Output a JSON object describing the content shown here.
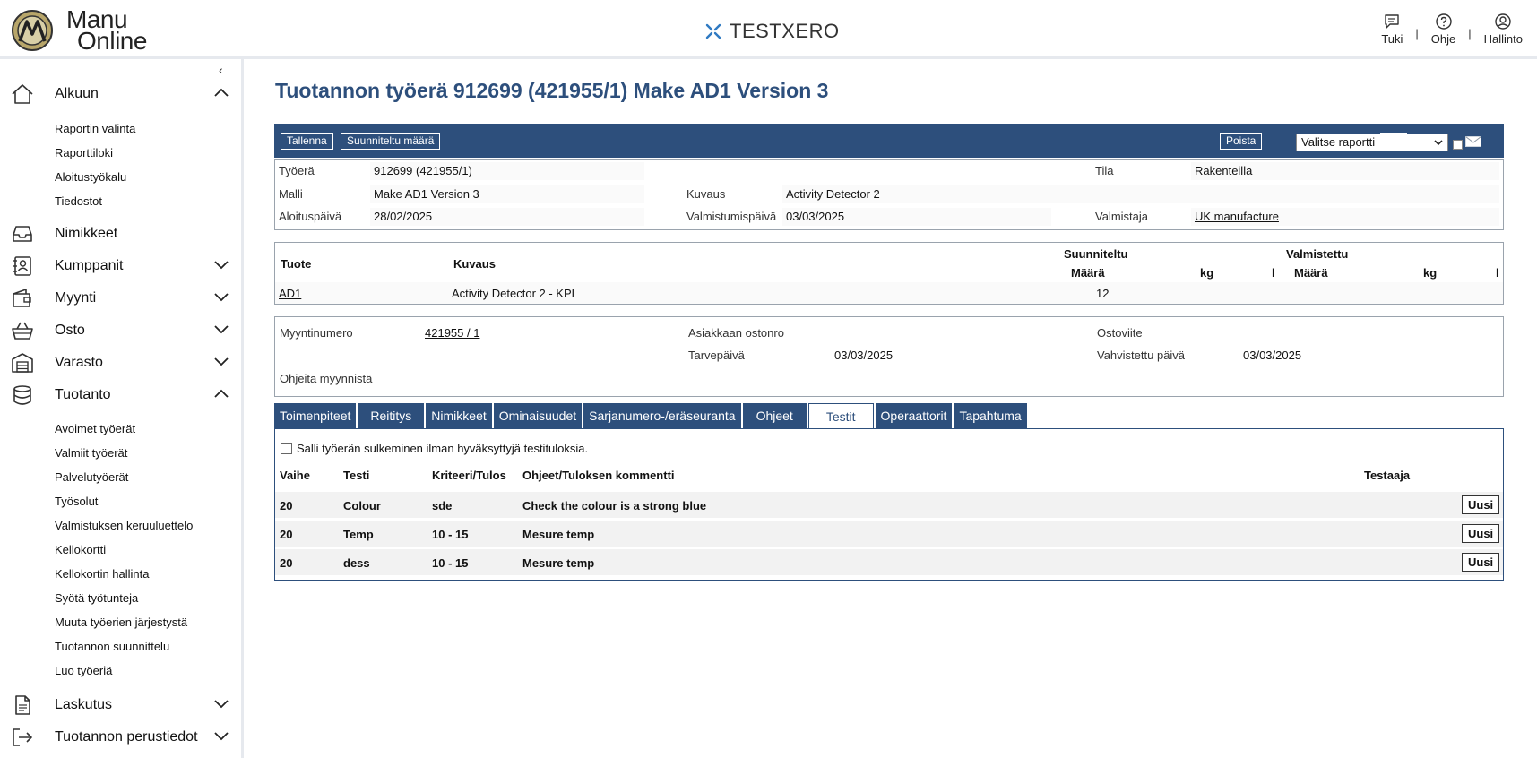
{
  "header": {
    "logo_line1": "Manu",
    "logo_line2": "Online",
    "brand": "TESTXERO",
    "links": {
      "support": "Tuki",
      "help": "Ohje",
      "admin": "Hallinto"
    },
    "separator": "|"
  },
  "sidebar": {
    "collapse_glyph": "‹",
    "sections": {
      "alkuun": {
        "label": "Alkuun",
        "icon": "home-icon",
        "expanded": true
      },
      "nimikkeet": {
        "label": "Nimikkeet",
        "icon": "inbox-icon"
      },
      "kumppanit": {
        "label": "Kumppanit",
        "icon": "contacts-icon",
        "expanded": false
      },
      "myynti": {
        "label": "Myynti",
        "icon": "wallet-icon",
        "expanded": false
      },
      "osto": {
        "label": "Osto",
        "icon": "basket-icon",
        "expanded": false
      },
      "varasto": {
        "label": "Varasto",
        "icon": "warehouse-icon",
        "expanded": false
      },
      "tuotanto": {
        "label": "Tuotanto",
        "icon": "database-icon",
        "expanded": true
      },
      "laskutus": {
        "label": "Laskutus",
        "icon": "document-icon",
        "expanded": false
      },
      "perustiedot": {
        "label": "Tuotannon perustiedot",
        "icon": "exit-icon",
        "expanded": false
      }
    },
    "alkuun_items": [
      "Raportin valinta",
      "Raporttiloki",
      "Aloitustyökalu",
      "Tiedostot"
    ],
    "tuotanto_items": [
      "Avoimet työerät",
      "Valmiit työerät",
      "Palvelutyöerät",
      "Työsolut",
      "Valmistuksen keruuluettelo",
      "Kellokortti",
      "Kellokortin hallinta",
      "Syötä työtunteja",
      "Muuta työerien järjestystä",
      "Tuotannon suunnittelu",
      "Luo työeriä"
    ]
  },
  "main": {
    "title": "Tuotannon työerä 912699 (421955/1) Make AD1 Version 3",
    "toolbar": {
      "save": "Tallenna",
      "planned_qty": "Suunniteltu määrä",
      "delete": "Poista",
      "report_select": "Valitse raportti",
      "attach_glyph": "✎"
    },
    "details": {
      "tyoera_label": "Työerä",
      "tyoera_value": "912699 (421955/1)",
      "tila_label": "Tila",
      "tila_value": "Rakenteilla",
      "malli_label": "Malli",
      "malli_value": "Make AD1 Version 3",
      "kuvaus_label": "Kuvaus",
      "kuvaus_value": "Activity Detector 2",
      "aloitus_label": "Aloituspäivä",
      "aloitus_value": "28/02/2025",
      "valmistumis_label": "Valmistumispäivä",
      "valmistumis_value": "03/03/2025",
      "valmistaja_label": "Valmistaja",
      "valmistaja_value": "UK manufacture"
    },
    "product_grid": {
      "col_product": "Tuote",
      "col_desc": "Kuvaus",
      "group_planned": "Suunniteltu",
      "group_made": "Valmistettu",
      "sub_qty": "Määrä",
      "sub_kg": "kg",
      "sub_l": "l",
      "rows": [
        {
          "product": "AD1",
          "desc": "Activity Detector 2 - KPL",
          "planned_qty": "12"
        }
      ]
    },
    "sales": {
      "myyntinumero_label": "Myyntinumero",
      "myyntinumero_value": "421955 / 1",
      "asiakas_label": "Asiakkaan ostonro",
      "asiakas_value": "",
      "ostoviite_label": "Ostoviite",
      "ostoviite_value": "",
      "tarve_label": "Tarvepäivä",
      "tarve_value": "03/03/2025",
      "vahvistettu_label": "Vahvistettu päivä",
      "vahvistettu_value": "03/03/2025",
      "ohjeita_label": "Ohjeita myynnistä",
      "ohjeita_value": ""
    },
    "tabs": [
      "Toimenpiteet",
      "Reititys",
      "Nimikkeet",
      "Ominaisuudet",
      "Sarjanumero-/eräseuranta",
      "Ohjeet",
      "Testit",
      "Operaattorit",
      "Tapahtuma"
    ],
    "active_tab": "Testit",
    "tests": {
      "allow_close_label": "Salli työerän sulkeminen ilman hyväksyttyjä testituloksia.",
      "allow_close_checked": false,
      "headers": {
        "phase": "Vaihe",
        "test": "Testi",
        "criteria": "Kriteeri/Tulos",
        "comment": "Ohjeet/Tuloksen kommentti",
        "tester": "Testaaja"
      },
      "new_label": "Uusi",
      "rows": [
        {
          "phase": "20",
          "test": "Colour",
          "criteria": "sde",
          "comment": "Check the colour is a strong blue",
          "tester": ""
        },
        {
          "phase": "20",
          "test": "Temp",
          "criteria": "10 - 15",
          "comment": "Mesure temp",
          "tester": ""
        },
        {
          "phase": "20",
          "test": "dess",
          "criteria": "10 - 15",
          "comment": "Mesure temp",
          "tester": ""
        }
      ]
    }
  },
  "colors": {
    "brand_blue": "#2d4f7c",
    "brand_x": "#2f7ac2",
    "logo_gold": "#b8a66a"
  }
}
